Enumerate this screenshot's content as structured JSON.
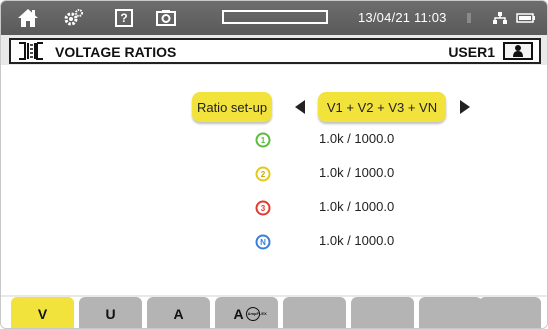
{
  "status_bar": {
    "icons": [
      "home-icon",
      "settings-gears-icon",
      "help-icon",
      "camera-icon"
    ],
    "help_label": "?",
    "progress_fraction": 0,
    "datetime": "13/04/21 11:03",
    "right_icons": [
      "recording-icon",
      "network-icon",
      "battery-icon"
    ]
  },
  "title_bar": {
    "icon": "voltage-ratio-icon",
    "title": "VOLTAGE RATIOS",
    "user_label": "USER1",
    "user_icon": "user-profile-icon"
  },
  "ratio_setup": {
    "label": "Ratio set-up",
    "selection": "V1 + V2 + V3 + VN",
    "prev_icon": "arrow-left-icon",
    "next_icon": "arrow-right-icon"
  },
  "ratios": [
    {
      "phase": "1",
      "color": "#5dbb3a",
      "value": "1.0k / 1000.0"
    },
    {
      "phase": "2",
      "color": "#e6c71a",
      "value": "1.0k / 1000.0"
    },
    {
      "phase": "3",
      "color": "#e23b2e",
      "value": "1.0k / 1000.0"
    },
    {
      "phase": "N",
      "color": "#3a7fd6",
      "value": "1.0k / 1000.0"
    }
  ],
  "tabs": [
    {
      "label": "V",
      "active": true
    },
    {
      "label": "U",
      "active": false
    },
    {
      "label": "A",
      "active": false
    },
    {
      "label": "A",
      "active": false,
      "badge": "AmpFLEX"
    },
    {
      "label": "",
      "active": false
    },
    {
      "label": "",
      "active": false
    },
    {
      "label": "",
      "active": false
    },
    {
      "label": "",
      "active": false
    }
  ],
  "colors": {
    "accent_yellow": "#f2e23c",
    "status_bar": "#636363",
    "tab_inactive": "#b4b4b4"
  }
}
